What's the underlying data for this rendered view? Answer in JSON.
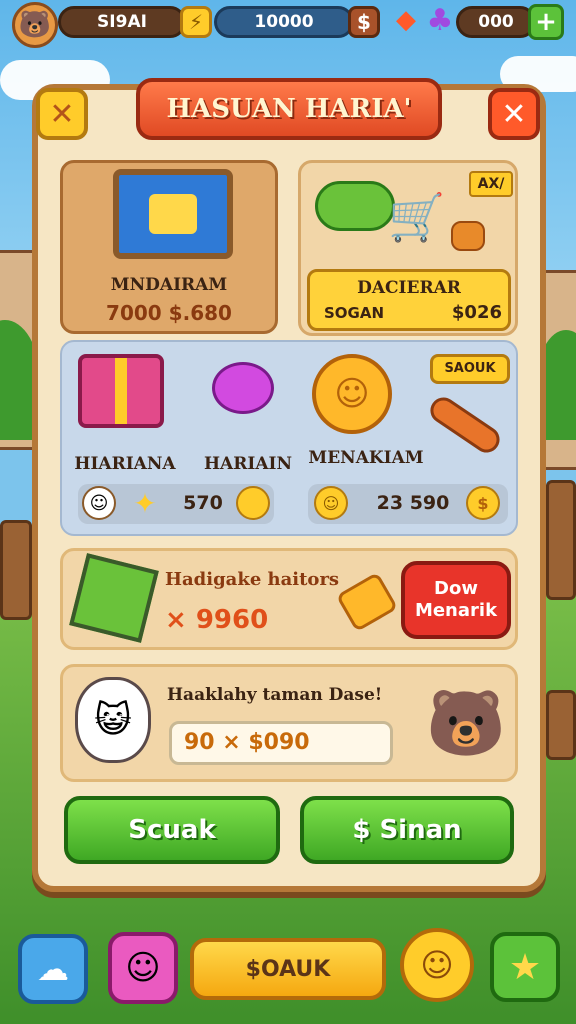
{
  "topbar": {
    "left_value": "SI9AI",
    "center_value": "10000",
    "right_value": "000",
    "plus_label": "+",
    "currency_symbol": "$",
    "bolt_glyph": "⚡"
  },
  "panel": {
    "title": "HASUAN HARIA'",
    "close_glyph": "✕",
    "back_glyph": "✕"
  },
  "shop": {
    "card1": {
      "name": "MNDAIRAM",
      "price": "7000 $.680"
    },
    "card2": {
      "badge": "AX/",
      "name": "DACIERAR",
      "sub": "SOGAN",
      "price": "$026"
    },
    "card3": {
      "label": "HIARIANA"
    },
    "card4": {
      "label": "HARIAIN"
    },
    "card5": {
      "label": "MENAKIAM",
      "bubble": "SAOUK"
    },
    "row_left_value": "570",
    "row_right_value": "23 590"
  },
  "offer": {
    "title": "Hadigake haitors",
    "value": "× 9960",
    "button": "Dow Menarik"
  },
  "reward": {
    "title": "Haaklahy taman Dase!",
    "value": "90 × $090"
  },
  "buttons": {
    "left": "Scuak",
    "right": "$ Sinan"
  },
  "bottombar": {
    "center": "$OAUK"
  },
  "colors": {
    "panel": "#f6e6c4",
    "panel_border": "#b57838",
    "title_red": "#e04a24",
    "green": "#5cc23a",
    "yellow": "#ffcc2a",
    "red_button": "#e8342a"
  }
}
